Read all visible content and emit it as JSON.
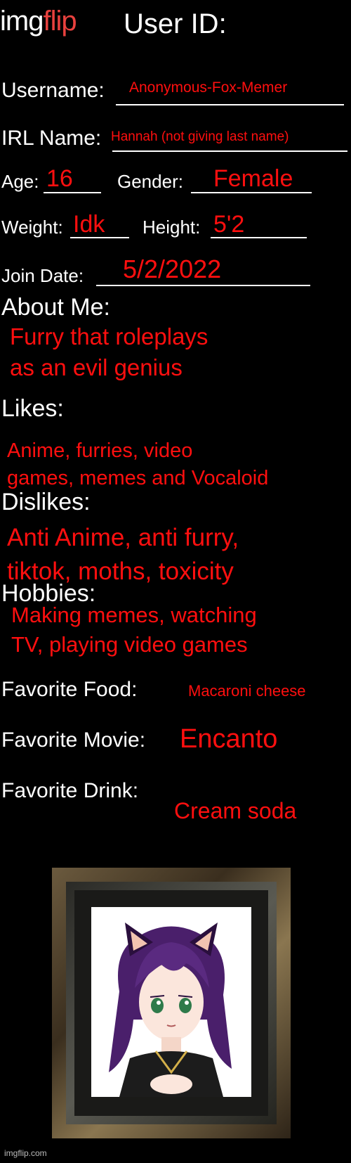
{
  "header": {
    "logo_img": "img",
    "logo_flip": "flip",
    "title": "User ID:"
  },
  "labels": {
    "username": "Username:",
    "irl_name": "IRL Name:",
    "age": "Age:",
    "gender": "Gender:",
    "weight": "Weight:",
    "height": "Height:",
    "join_date": "Join Date:",
    "about_me": "About Me:",
    "likes": "Likes:",
    "dislikes": "Dislikes:",
    "hobbies": "Hobbies:",
    "favorite_food": "Favorite Food:",
    "favorite_movie": "Favorite Movie:",
    "favorite_drink": "Favorite Drink:"
  },
  "answers": {
    "username": "Anonymous-Fox-Memer",
    "irl_name": "Hannah (not giving last name)",
    "age": "16",
    "gender": "Female",
    "weight": "Idk",
    "height": "5'2",
    "join_date": "5/2/2022",
    "about_me_line1": "Furry that roleplays",
    "about_me_line2": "as an evil genius",
    "likes_line1": "Anime, furries, video",
    "likes_line2": "games, memes and Vocaloid",
    "dislikes_line1": "Anti Anime, anti furry,",
    "dislikes_line2": "tiktok, moths, toxicity",
    "hobbies_line1": "Making memes, watching",
    "hobbies_line2": "TV, playing video games",
    "favorite_food": "Macaroni cheese",
    "favorite_movie": "Encanto",
    "favorite_drink": "Cream soda"
  },
  "watermark": "imgflip.com",
  "colors": {
    "background": "#000000",
    "label": "#ffffff",
    "answer": "#ff0f0f",
    "logo_accent": "#e8413e"
  }
}
